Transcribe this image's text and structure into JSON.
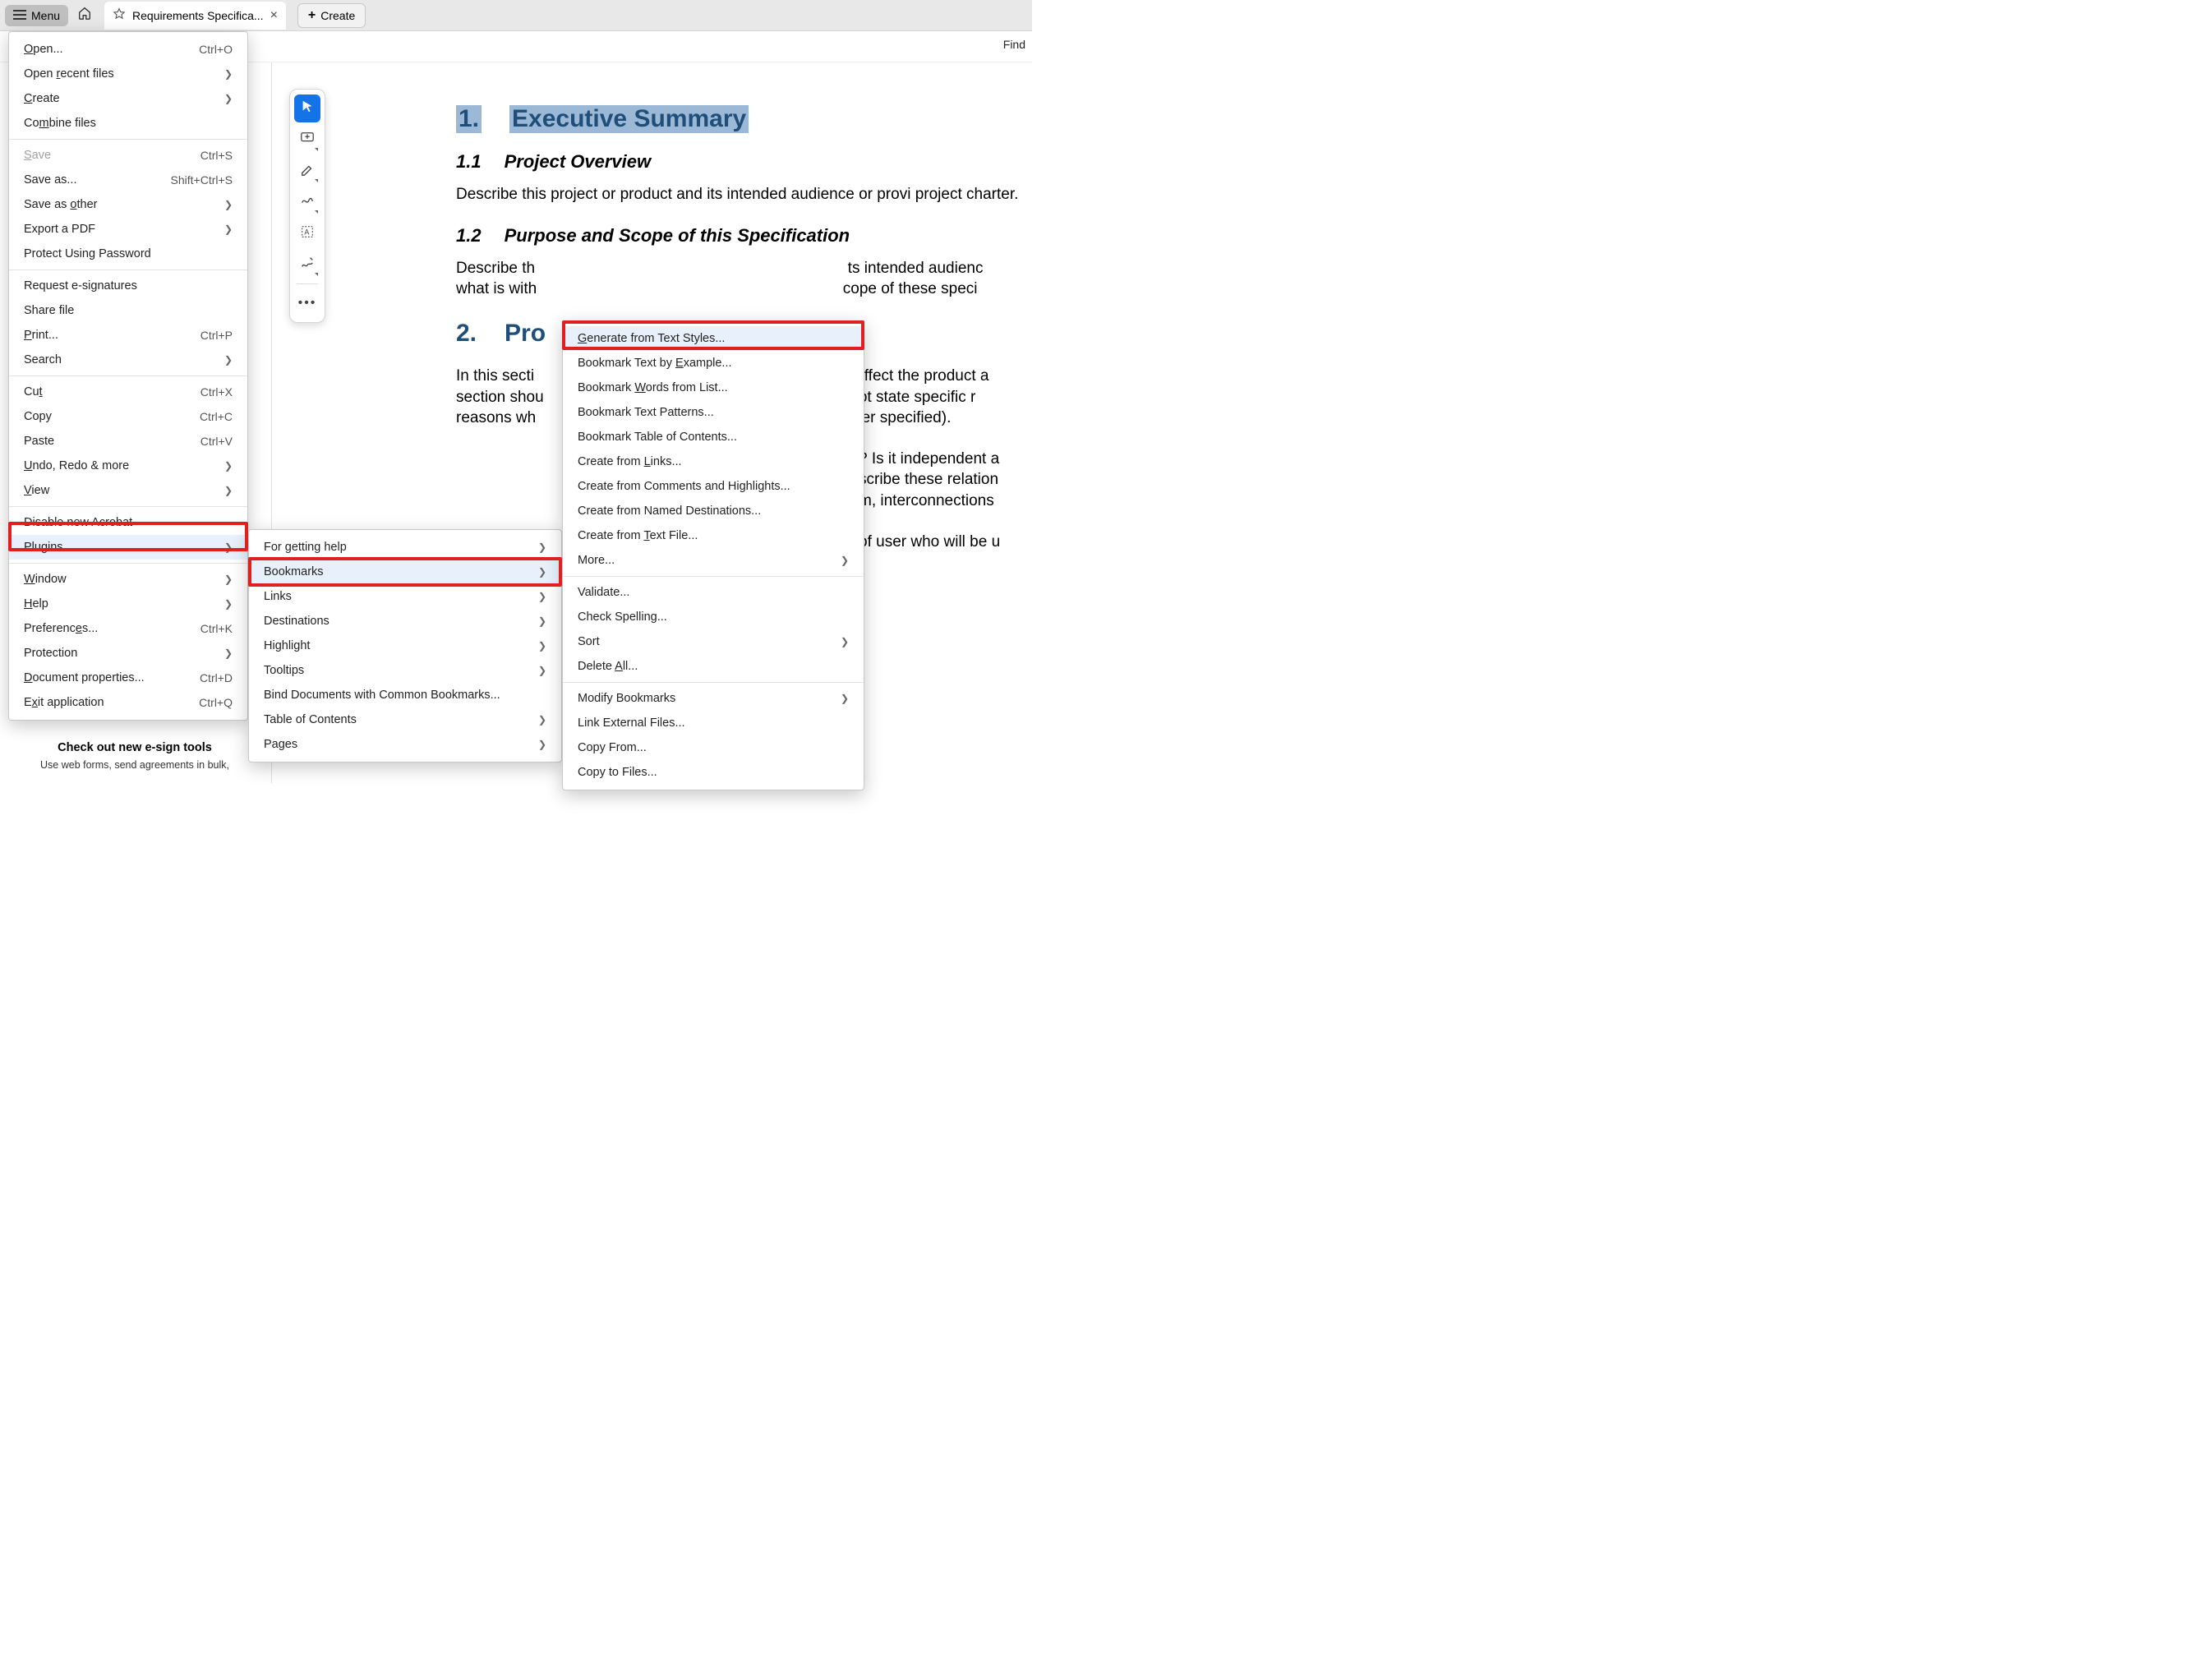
{
  "titlebar": {
    "menu_label": "Menu",
    "tab_title": "Requirements Specifica...",
    "create_label": "Create"
  },
  "subbar": {
    "find": "Find"
  },
  "main_menu": {
    "items": [
      {
        "label": "Open...",
        "accel": "Ctrl+O",
        "u": 0
      },
      {
        "label": "Open recent files",
        "chev": true,
        "u": 5
      },
      {
        "label": "Create",
        "chev": true,
        "u": 0
      },
      {
        "label": "Combine files",
        "u": 2
      },
      {
        "sep": true
      },
      {
        "label": "Save",
        "accel": "Ctrl+S",
        "disabled": true,
        "u": 0
      },
      {
        "label": "Save as...",
        "accel": "Shift+Ctrl+S"
      },
      {
        "label": "Save as other",
        "chev": true,
        "u": 8
      },
      {
        "label": "Export a PDF",
        "chev": true
      },
      {
        "label": "Protect Using Password"
      },
      {
        "sep": true
      },
      {
        "label": "Request e-signatures"
      },
      {
        "label": "Share file"
      },
      {
        "label": "Print...",
        "accel": "Ctrl+P",
        "u": 0
      },
      {
        "label": "Search",
        "chev": true
      },
      {
        "sep": true
      },
      {
        "label": "Cut",
        "accel": "Ctrl+X",
        "u": 2
      },
      {
        "label": "Copy",
        "accel": "Ctrl+C"
      },
      {
        "label": "Paste",
        "accel": "Ctrl+V"
      },
      {
        "label": "Undo, Redo & more",
        "chev": true,
        "u": 0
      },
      {
        "label": "View",
        "chev": true,
        "u": 0
      },
      {
        "sep": true
      },
      {
        "label": "Disable new Acrobat"
      },
      {
        "label": "Plugins",
        "chev": true,
        "hovered": true
      },
      {
        "sep": true
      },
      {
        "label": "Window",
        "chev": true,
        "u": 0
      },
      {
        "label": "Help",
        "chev": true,
        "u": 0
      },
      {
        "label": "Preferences...",
        "accel": "Ctrl+K",
        "u": 9
      },
      {
        "label": "Protection",
        "chev": true
      },
      {
        "label": "Document properties...",
        "accel": "Ctrl+D",
        "u": 0
      },
      {
        "label": "Exit application",
        "accel": "Ctrl+Q",
        "u": 1
      }
    ]
  },
  "submenu1": {
    "items": [
      {
        "label": "For getting help",
        "chev": true
      },
      {
        "label": "Bookmarks",
        "chev": true,
        "hovered": true
      },
      {
        "label": "Links",
        "chev": true
      },
      {
        "label": "Destinations",
        "chev": true
      },
      {
        "label": "Highlight",
        "chev": true
      },
      {
        "label": "Tooltips",
        "chev": true
      },
      {
        "label": "Bind Documents with Common Bookmarks..."
      },
      {
        "label": "Table of Contents",
        "chev": true
      },
      {
        "label": "Pages",
        "chev": true
      }
    ]
  },
  "submenu2": {
    "items": [
      {
        "label": "Generate from Text Styles...",
        "hovered": true,
        "u": 0
      },
      {
        "label": "Bookmark Text by Example...",
        "u": 17
      },
      {
        "label": "Bookmark Words from List...",
        "u": 9
      },
      {
        "label": "Bookmark Text Patterns..."
      },
      {
        "label": "Bookmark Table of Contents..."
      },
      {
        "label": "Create from Links...",
        "u": 12
      },
      {
        "label": "Create from Comments and Highlights..."
      },
      {
        "label": "Create from Named Destinations..."
      },
      {
        "label": "Create from Text File...",
        "u": 12
      },
      {
        "label": "More...",
        "chev": true
      },
      {
        "sep": true
      },
      {
        "label": "Validate..."
      },
      {
        "label": "Check Spelling..."
      },
      {
        "label": "Sort",
        "chev": true
      },
      {
        "label": "Delete All...",
        "u": 7
      },
      {
        "sep": true
      },
      {
        "label": "Modify Bookmarks",
        "chev": true
      },
      {
        "label": "Link External Files..."
      },
      {
        "label": "Copy From..."
      },
      {
        "label": "Copy to Files..."
      }
    ]
  },
  "document": {
    "h1_num": "1.",
    "h1_title": "Executive Summary",
    "h2a_num": "1.1",
    "h2a_title": "Project Overview",
    "para1": "Describe this project or product and its intended audience or provi project charter.",
    "h2b_num": "1.2",
    "h2b_title": "Purpose and Scope of this Specification",
    "para2a": "Describe th",
    "para2b": "ts intended audienc",
    "para2c": "what is with",
    "para2d": "cope of these speci",
    "h1b_num": "2.",
    "h1b_title": "Pro",
    "para3a": "In this secti",
    "para3b": "t affect the product a",
    "para3c": "section shou",
    "para3d": " not state specific r",
    "para3e": "reasons wh",
    "para3f": "ater specified).",
    "para4a": "? Is it independent a",
    "para4b": "scribe these relation",
    "para4c": "m, interconnections",
    "para5": "of user who will be u"
  },
  "esign": {
    "title": "Check out new e-sign tools",
    "sub": "Use web forms, send agreements in bulk,"
  }
}
